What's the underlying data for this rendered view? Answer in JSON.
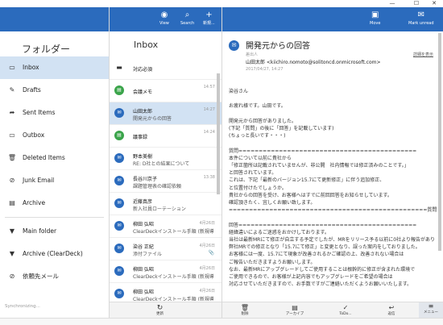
{
  "window": {
    "minimize_glyph": "—",
    "maximize_glyph": "☐",
    "close_glyph": "✕"
  },
  "folders": {
    "title": "フォルダー",
    "items": [
      {
        "label": "Inbox",
        "icon": "inbox-icon",
        "glyph": "▭",
        "selected": true
      },
      {
        "label": "Drafts",
        "icon": "pencil-icon",
        "glyph": "✎"
      },
      {
        "label": "Sent Items",
        "icon": "send-icon",
        "glyph": "➦"
      },
      {
        "label": "Outbox",
        "icon": "outbox-icon",
        "glyph": "▭"
      },
      {
        "label": "Deleted Items",
        "icon": "trash-icon",
        "glyph": "🗑"
      },
      {
        "label": "Junk Email",
        "icon": "block-icon",
        "glyph": "⊘"
      },
      {
        "label": "Archive",
        "icon": "archive-icon",
        "glyph": "▤"
      },
      {
        "label": "Main folder",
        "icon": "chevron-down-icon",
        "glyph": "▼",
        "group": true
      },
      {
        "label": "Archive (ClearDeck)",
        "icon": "chevron-down-icon",
        "glyph": "▼",
        "group": true
      },
      {
        "label": "依頼先メール",
        "icon": "block-icon",
        "glyph": "⊘"
      }
    ],
    "sync_status": "Synchronizing..."
  },
  "list": {
    "title": "Inbox",
    "toolbar": {
      "view_label": "View",
      "search_label": "Search",
      "new_label": "新規..."
    },
    "messages": [
      {
        "sender": "対応必須",
        "subject": "",
        "time": "",
        "avatar": "",
        "type": "folder"
      },
      {
        "sender": "会議メモ",
        "subject": "",
        "time": "14:57",
        "avatar": "▤",
        "type": "green"
      },
      {
        "sender": "山田太郎",
        "subject": "開発元からの回答",
        "time": "14:27",
        "avatar": "✉",
        "type": "blue",
        "selected": true
      },
      {
        "sender": "議事録",
        "subject": "",
        "time": "14:24",
        "avatar": "▤",
        "type": "green"
      },
      {
        "sender": "野本美樹",
        "subject": "RE: D社との結果について",
        "time": "",
        "avatar": "✉",
        "type": "blue"
      },
      {
        "sender": "長谷川京子",
        "subject": "課題管理表の確認依頼",
        "time": "13:38",
        "avatar": "✉",
        "type": "blue"
      },
      {
        "sender": "近藤真彦",
        "subject": "新入社員ローテーション",
        "time": "",
        "avatar": "✉",
        "type": "blue"
      },
      {
        "sender": "柳田 弘昭",
        "subject": "ClearDeckインストール手順 (新規導入…",
        "time": "4月26日",
        "avatar": "✉",
        "type": "blue"
      },
      {
        "sender": "染谷 正紀",
        "subject": "添付ファイル",
        "time": "4月26日",
        "avatar": "✉",
        "type": "blue",
        "attachment": "📎"
      },
      {
        "sender": "柳田 弘昭",
        "subject": "ClearDeckインストール手順 (新規導入…",
        "time": "4月26日",
        "avatar": "✉",
        "type": "blue"
      },
      {
        "sender": "柳田 弘昭",
        "subject": "ClearDeckインストール手順 (新規導入…",
        "time": "4月26日",
        "avatar": "✉",
        "type": "blue"
      }
    ],
    "refresh_label": "更新"
  },
  "reader": {
    "toolbar": {
      "move_label": "Move",
      "mark_unread_label": "Mark unread"
    },
    "subject": "開発元からの回答",
    "from_label": "差出人",
    "from": "山田太郎 <kiichiro.nomoto@solitoncd.onmicrosoft.com>",
    "date": "2017/04/27, 14:27",
    "thread_link": "詳細を表示",
    "body_lines": [
      "染谷さん",
      "",
      "お疲れ様です。山田です。",
      "",
      "開発元から回答がありました。",
      "(下記「質問」の後に「回答」を記載しています)",
      "(ちょっと長いです・・・)",
      "",
      "質問============================================",
      "本件について以前に貴社から",
      "「修正箇所は記載されていませんが、非公開　社内情報では修正済みのことです。」",
      "と回答されています。",
      "これは、下記「最新のバージョン15.7にて更新修正」に伴う追加修正、",
      "と位置付けたでしょうか。",
      "貴社からの回答を受け、お客様へはすでに前回回答をお知らせしています。",
      "確認頂きたく、宜しくお願い致します。",
      "=================================================質問",
      "",
      "回答============================================",
      "経緯違いによるご迷惑をおかけしております。",
      "当社は最新MRにて修正が自立する予定でしたが、MRをリリース予る以前に0社より報告があり",
      "弊社MRでの修正となり「15.7にて修正」と変更となり、誤った案内をしておりました。",
      "お客様には一度、15.7にて現象が改善されるかご確認の上、改善されない場合は",
      "ご報告いただきますようお願いします。",
      "なお、最新MRにアップグレードしてご使用することは根幹的に修正が含まれた環境で",
      "ご使用できるので、お客様が上記内容でもアップグレードをご希望の場合は",
      "対応させていただきますので、お手数ですがご連絡いただくようお願いいたします。"
    ],
    "actions": {
      "delete_label": "削除",
      "archive_label": "アーカイブ",
      "todo_label": "ToDo...",
      "reply_label": "返信",
      "menu_label": "メニュー"
    }
  },
  "colors": {
    "accent": "#2b6bbd",
    "selection": "#d2e2f3",
    "green": "#3aa44a"
  }
}
